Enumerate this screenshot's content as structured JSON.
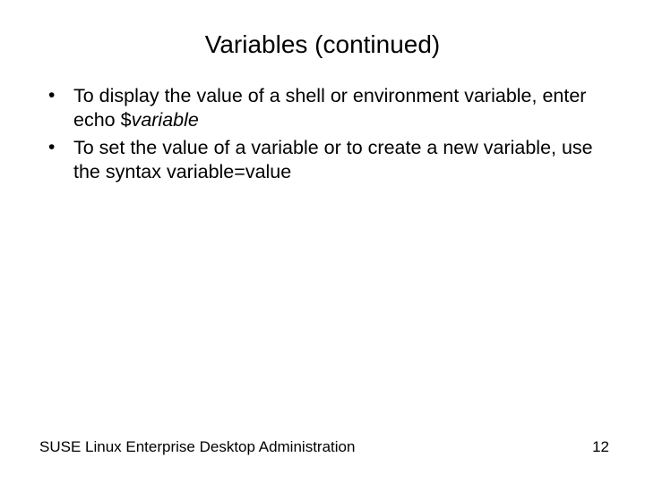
{
  "title": "Variables (continued)",
  "bullets": [
    {
      "pre": "To display the value of a shell or environment variable, enter echo $",
      "italic": "variable",
      "post": ""
    },
    {
      "pre": "To set the value of a variable or to create a new variable, use the syntax variable=value",
      "italic": "",
      "post": ""
    }
  ],
  "footer": {
    "left": "SUSE Linux Enterprise Desktop Administration",
    "page": "12"
  }
}
